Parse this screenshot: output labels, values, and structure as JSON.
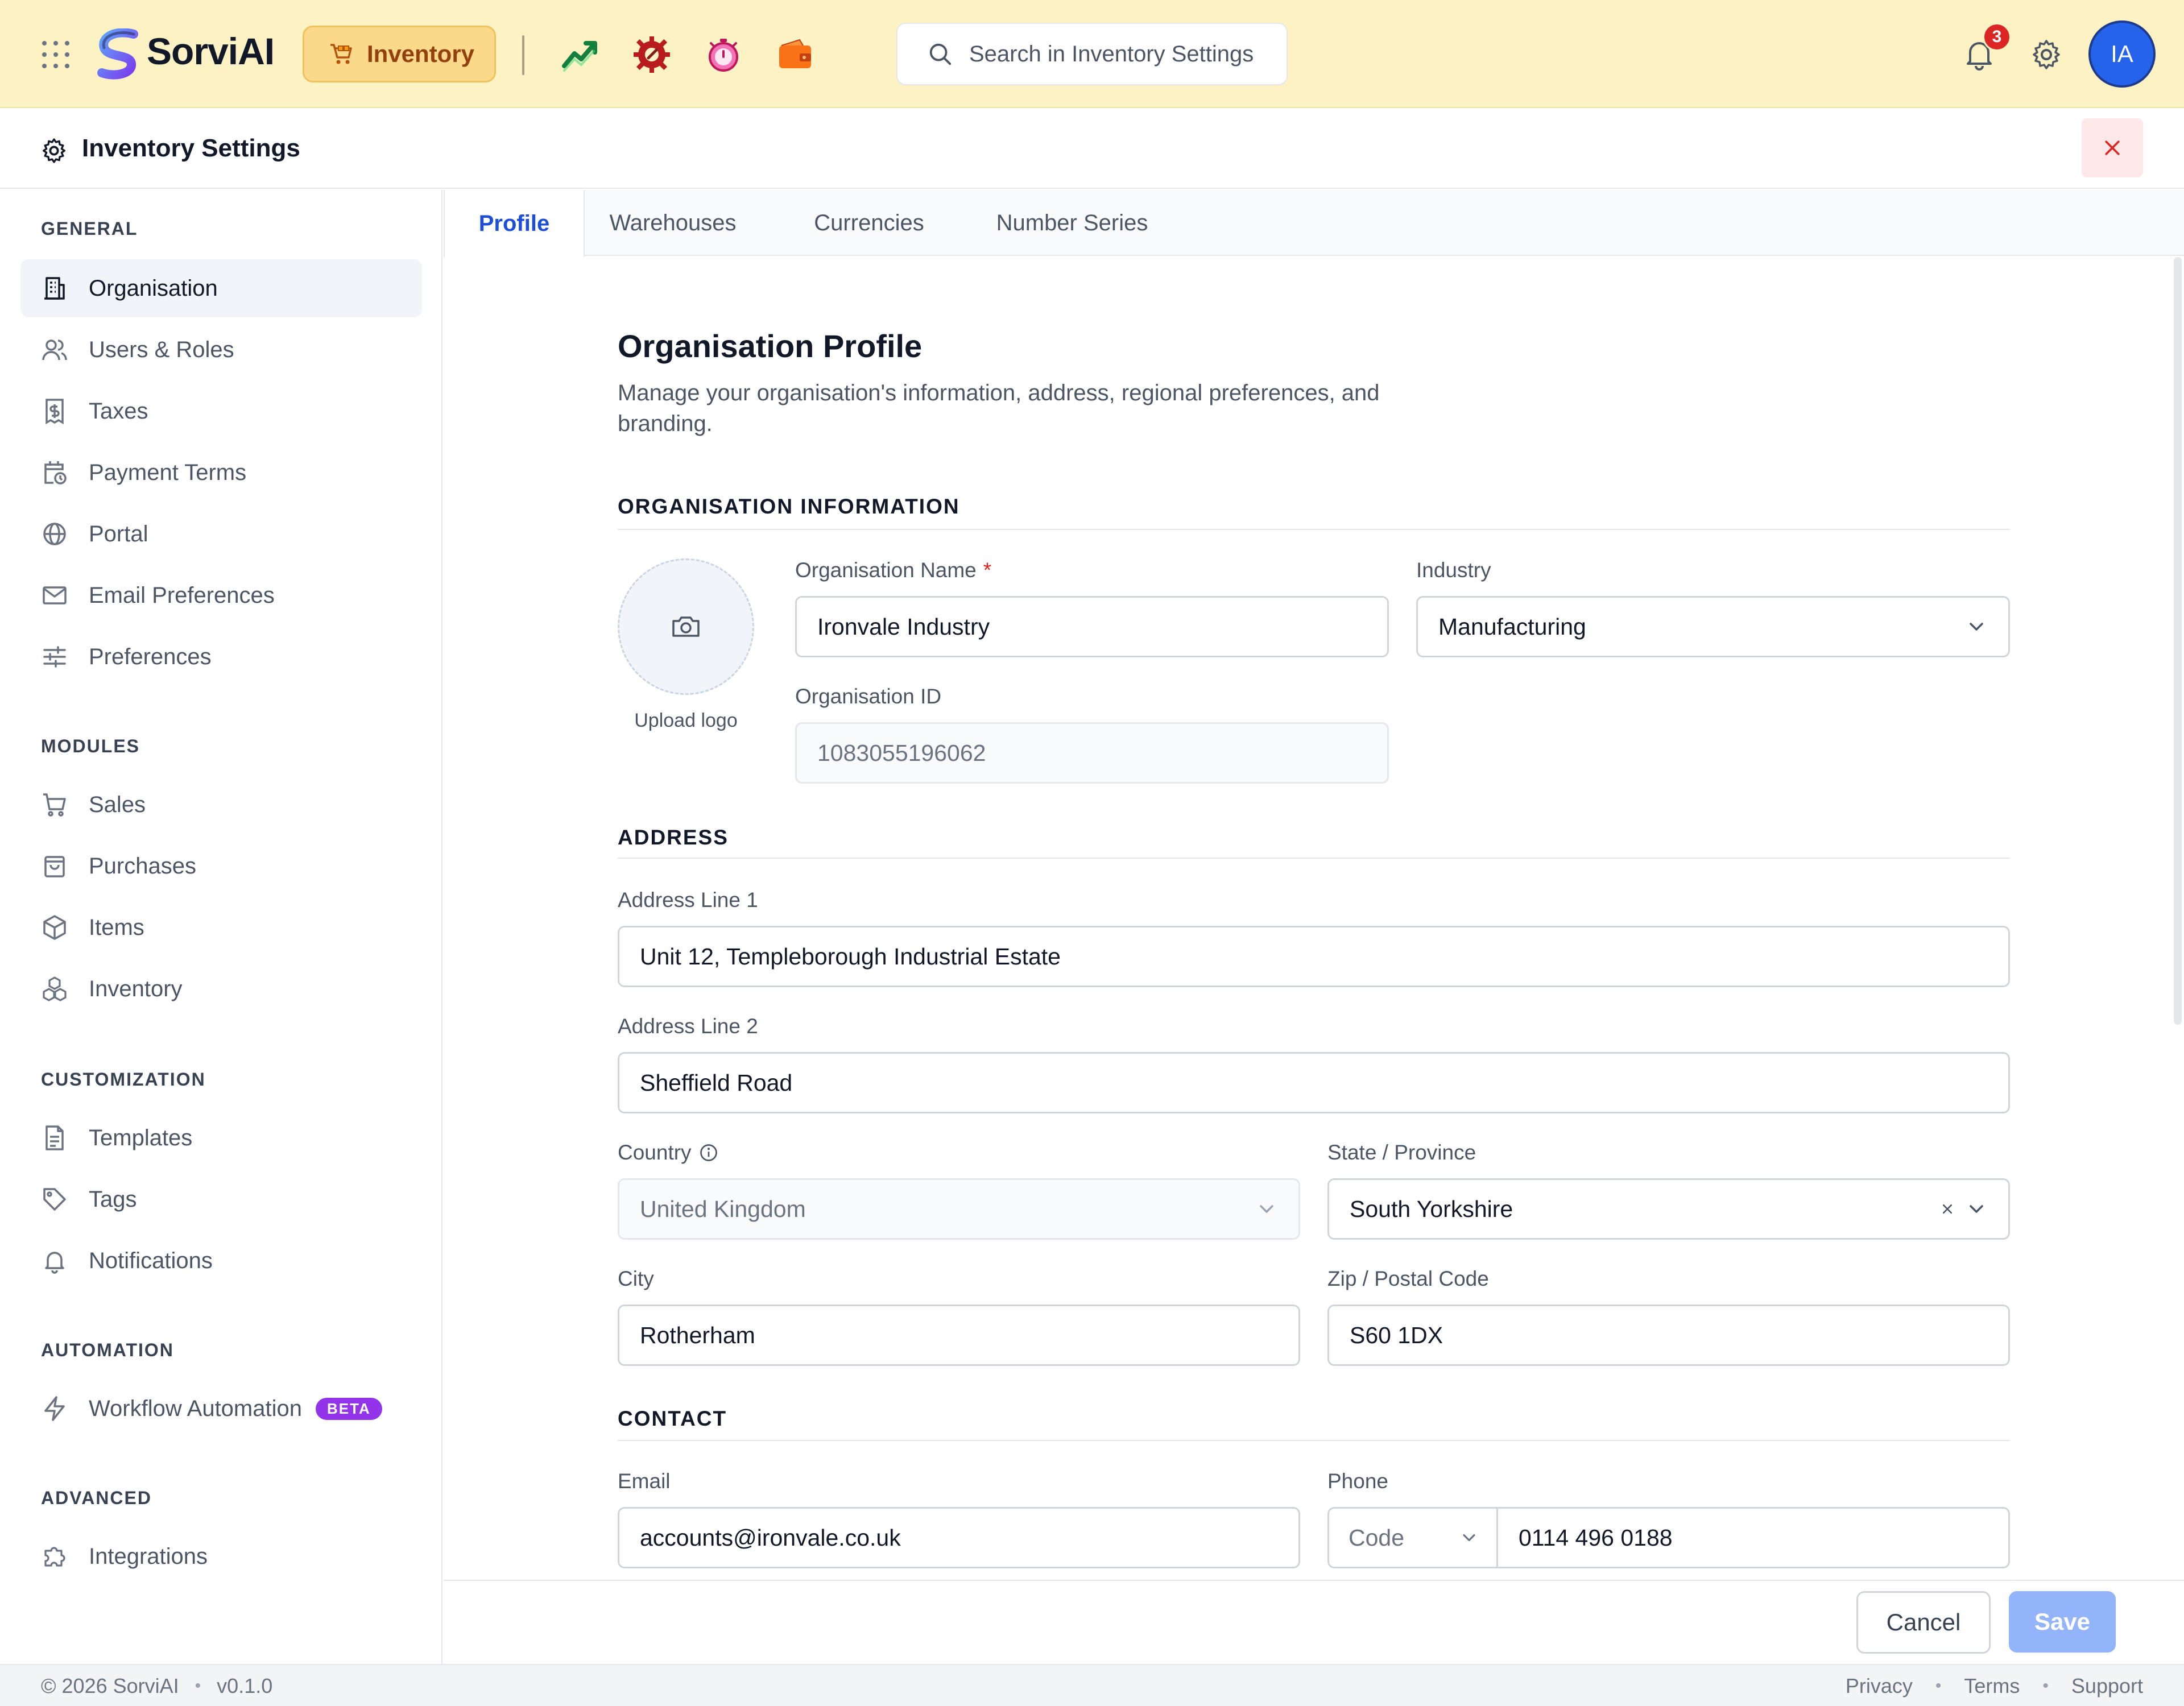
{
  "topbar": {
    "brand": "SorviAI",
    "module_label": "Inventory",
    "search_placeholder": "Search in Inventory Settings",
    "notification_count": "3",
    "avatar_initials": "IA",
    "app_icons": [
      "trending-chart-icon",
      "gear-wrench-icon",
      "timer-icon",
      "wallet-icon"
    ]
  },
  "page": {
    "title": "Inventory Settings"
  },
  "sidebar": {
    "sections": [
      {
        "title": "GENERAL",
        "items": [
          {
            "label": "Organisation",
            "icon": "building-icon",
            "active": true
          },
          {
            "label": "Users & Roles",
            "icon": "users-icon"
          },
          {
            "label": "Taxes",
            "icon": "receipt-dollar-icon"
          },
          {
            "label": "Payment Terms",
            "icon": "calendar-clock-icon"
          },
          {
            "label": "Portal",
            "icon": "globe-icon"
          },
          {
            "label": "Email Preferences",
            "icon": "mail-icon"
          },
          {
            "label": "Preferences",
            "icon": "sliders-icon"
          }
        ]
      },
      {
        "title": "MODULES",
        "items": [
          {
            "label": "Sales",
            "icon": "cart-icon"
          },
          {
            "label": "Purchases",
            "icon": "bag-icon"
          },
          {
            "label": "Items",
            "icon": "box-icon"
          },
          {
            "label": "Inventory",
            "icon": "boxes-icon"
          }
        ]
      },
      {
        "title": "CUSTOMIZATION",
        "items": [
          {
            "label": "Templates",
            "icon": "file-text-icon"
          },
          {
            "label": "Tags",
            "icon": "tag-icon"
          },
          {
            "label": "Notifications",
            "icon": "bell-icon"
          }
        ]
      },
      {
        "title": "AUTOMATION",
        "items": [
          {
            "label": "Workflow Automation",
            "icon": "lightning-icon",
            "badge": "BETA"
          }
        ]
      },
      {
        "title": "ADVANCED",
        "items": [
          {
            "label": "Integrations",
            "icon": "puzzle-icon"
          }
        ]
      }
    ]
  },
  "tabs": [
    {
      "label": "Profile",
      "active": true
    },
    {
      "label": "Warehouses"
    },
    {
      "label": "Currencies"
    },
    {
      "label": "Number Series"
    }
  ],
  "profile": {
    "heading": "Organisation Profile",
    "description": "Manage your organisation's information, address, regional preferences, and branding.",
    "org_section": "ORGANISATION INFORMATION",
    "upload_logo": "Upload logo",
    "org_name_label": "Organisation Name",
    "org_name_value": "Ironvale Industry",
    "industry_label": "Industry",
    "industry_value": "Manufacturing",
    "org_id_label": "Organisation ID",
    "org_id_value": "1083055196062",
    "address_section": "ADDRESS",
    "address1_label": "Address Line 1",
    "address1_value": "Unit 12, Templeborough Industrial Estate",
    "address2_label": "Address Line 2",
    "address2_value": "Sheffield Road",
    "country_label": "Country",
    "country_value": "United Kingdom",
    "state_label": "State / Province",
    "state_value": "South Yorkshire",
    "city_label": "City",
    "city_value": "Rotherham",
    "zip_label": "Zip / Postal Code",
    "zip_value": "S60 1DX",
    "contact_section": "CONTACT",
    "email_label": "Email",
    "email_value": "accounts@ironvale.co.uk",
    "phone_label": "Phone",
    "phone_code_placeholder": "Code",
    "phone_value": "0114 496 0188"
  },
  "actions": {
    "cancel": "Cancel",
    "save": "Save"
  },
  "footer": {
    "copyright": "© 2026 SorviAI",
    "version": "v0.1.0",
    "links": [
      "Privacy",
      "Terms",
      "Support"
    ]
  },
  "colors": {
    "topbar_bg": "#fdf2c4",
    "accent": "#1d4ed8",
    "beta": "#9333ea",
    "required": "#dc2626"
  }
}
